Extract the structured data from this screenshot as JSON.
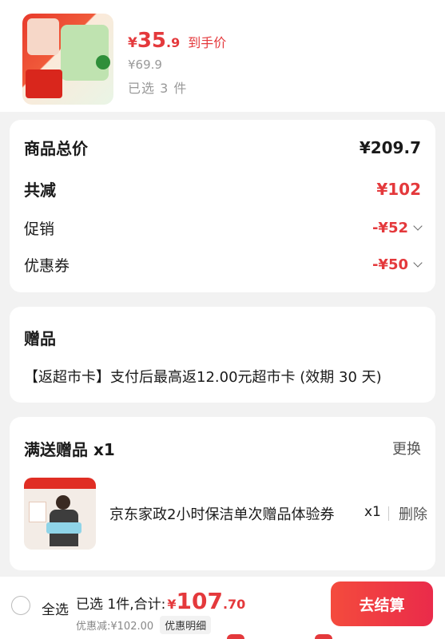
{
  "product": {
    "price_currency": "¥",
    "price_int": "35",
    "price_dec": ".9",
    "price_tag": "到手价",
    "original_price": "¥69.9",
    "selected_count": "已选 3 件"
  },
  "totals": {
    "total_label": "商品总价",
    "total_value": "¥209.7",
    "reduce_label": "共减",
    "reduce_value": "¥102",
    "promo_label": "促销",
    "promo_value": "-¥52",
    "coupon_label": "优惠券",
    "coupon_value": "-¥50"
  },
  "gift": {
    "title": "赠品",
    "desc": "【返超市卡】支付后最高返12.00元超市卡 (效期 30 天)"
  },
  "full_gift": {
    "title": "满送赠品 x1",
    "change_label": "更换",
    "item_name": "京东家政2小时保洁单次赠品体验券",
    "item_qty": "x1",
    "delete_label": "删除"
  },
  "bottom_bar": {
    "select_all_label": "全选",
    "summary_label": "已选 1件,合计:",
    "total_currency": "¥",
    "total_int": "107",
    "total_dec": ".70",
    "discount_text": "优惠减:¥102.00",
    "discount_detail_label": "优惠明细",
    "checkout_label": "去结算"
  },
  "colors": {
    "accent": "#e4393c",
    "background": "#f2f2f2"
  }
}
